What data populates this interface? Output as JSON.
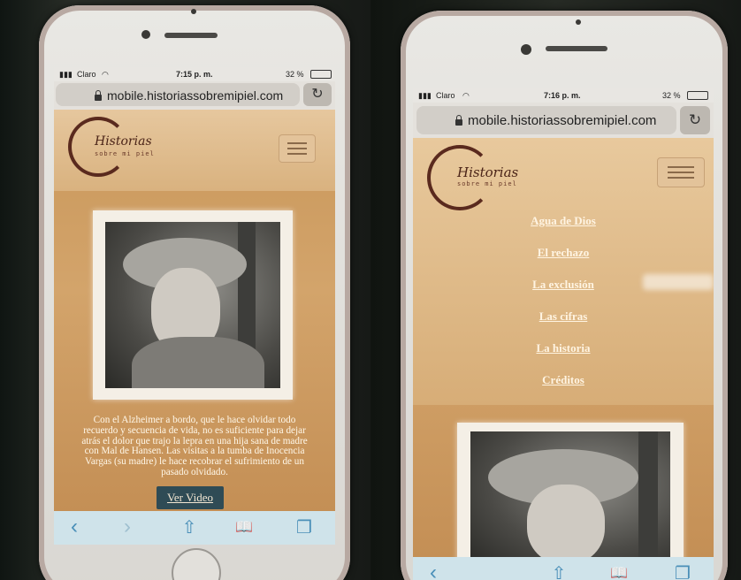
{
  "left_phone": {
    "status": {
      "carrier": "Claro",
      "time": "7:15 p. m.",
      "battery": "32 %"
    },
    "url": "mobile.historiassobremipiel.com",
    "logo": {
      "title": "Historias",
      "subtitle": "sobre mi piel"
    },
    "caption": "Con el Alzheimer a bordo, que le hace olvidar todo recuerdo y secuencia de vida, no es suficiente para dejar atrás el dolor que trajo la lepra en una hija sana de madre con Mal de Hansen. Las visitas a la tumba de Inocencia Vargas (su madre) le hace recobrar el sufrimiento de un pasado olvidado.",
    "video_button": "Ver Video",
    "toolbar": {
      "back": "‹",
      "forward": "›",
      "share": "⇧",
      "bookmarks": "📖",
      "tabs": "❐"
    }
  },
  "right_phone": {
    "status": {
      "carrier": "Claro",
      "time": "7:16 p. m.",
      "battery": "32 %"
    },
    "url": "mobile.historiassobremipiel.com",
    "logo": {
      "title": "Historias",
      "subtitle": "sobre mi piel"
    },
    "menu": [
      "Agua de Dios",
      "El rechazo",
      "La exclusión",
      "Las cifras",
      "La historia",
      "Créditos"
    ],
    "toolbar": {
      "back": "‹",
      "share": "⇧",
      "bookmarks": "📖",
      "tabs": "❐"
    }
  },
  "colors": {
    "site_bg": "#c9975a",
    "header_bg": "#e6c79e",
    "button_bg": "#2f4b55",
    "toolbar_tint": "#4a8fb8"
  }
}
